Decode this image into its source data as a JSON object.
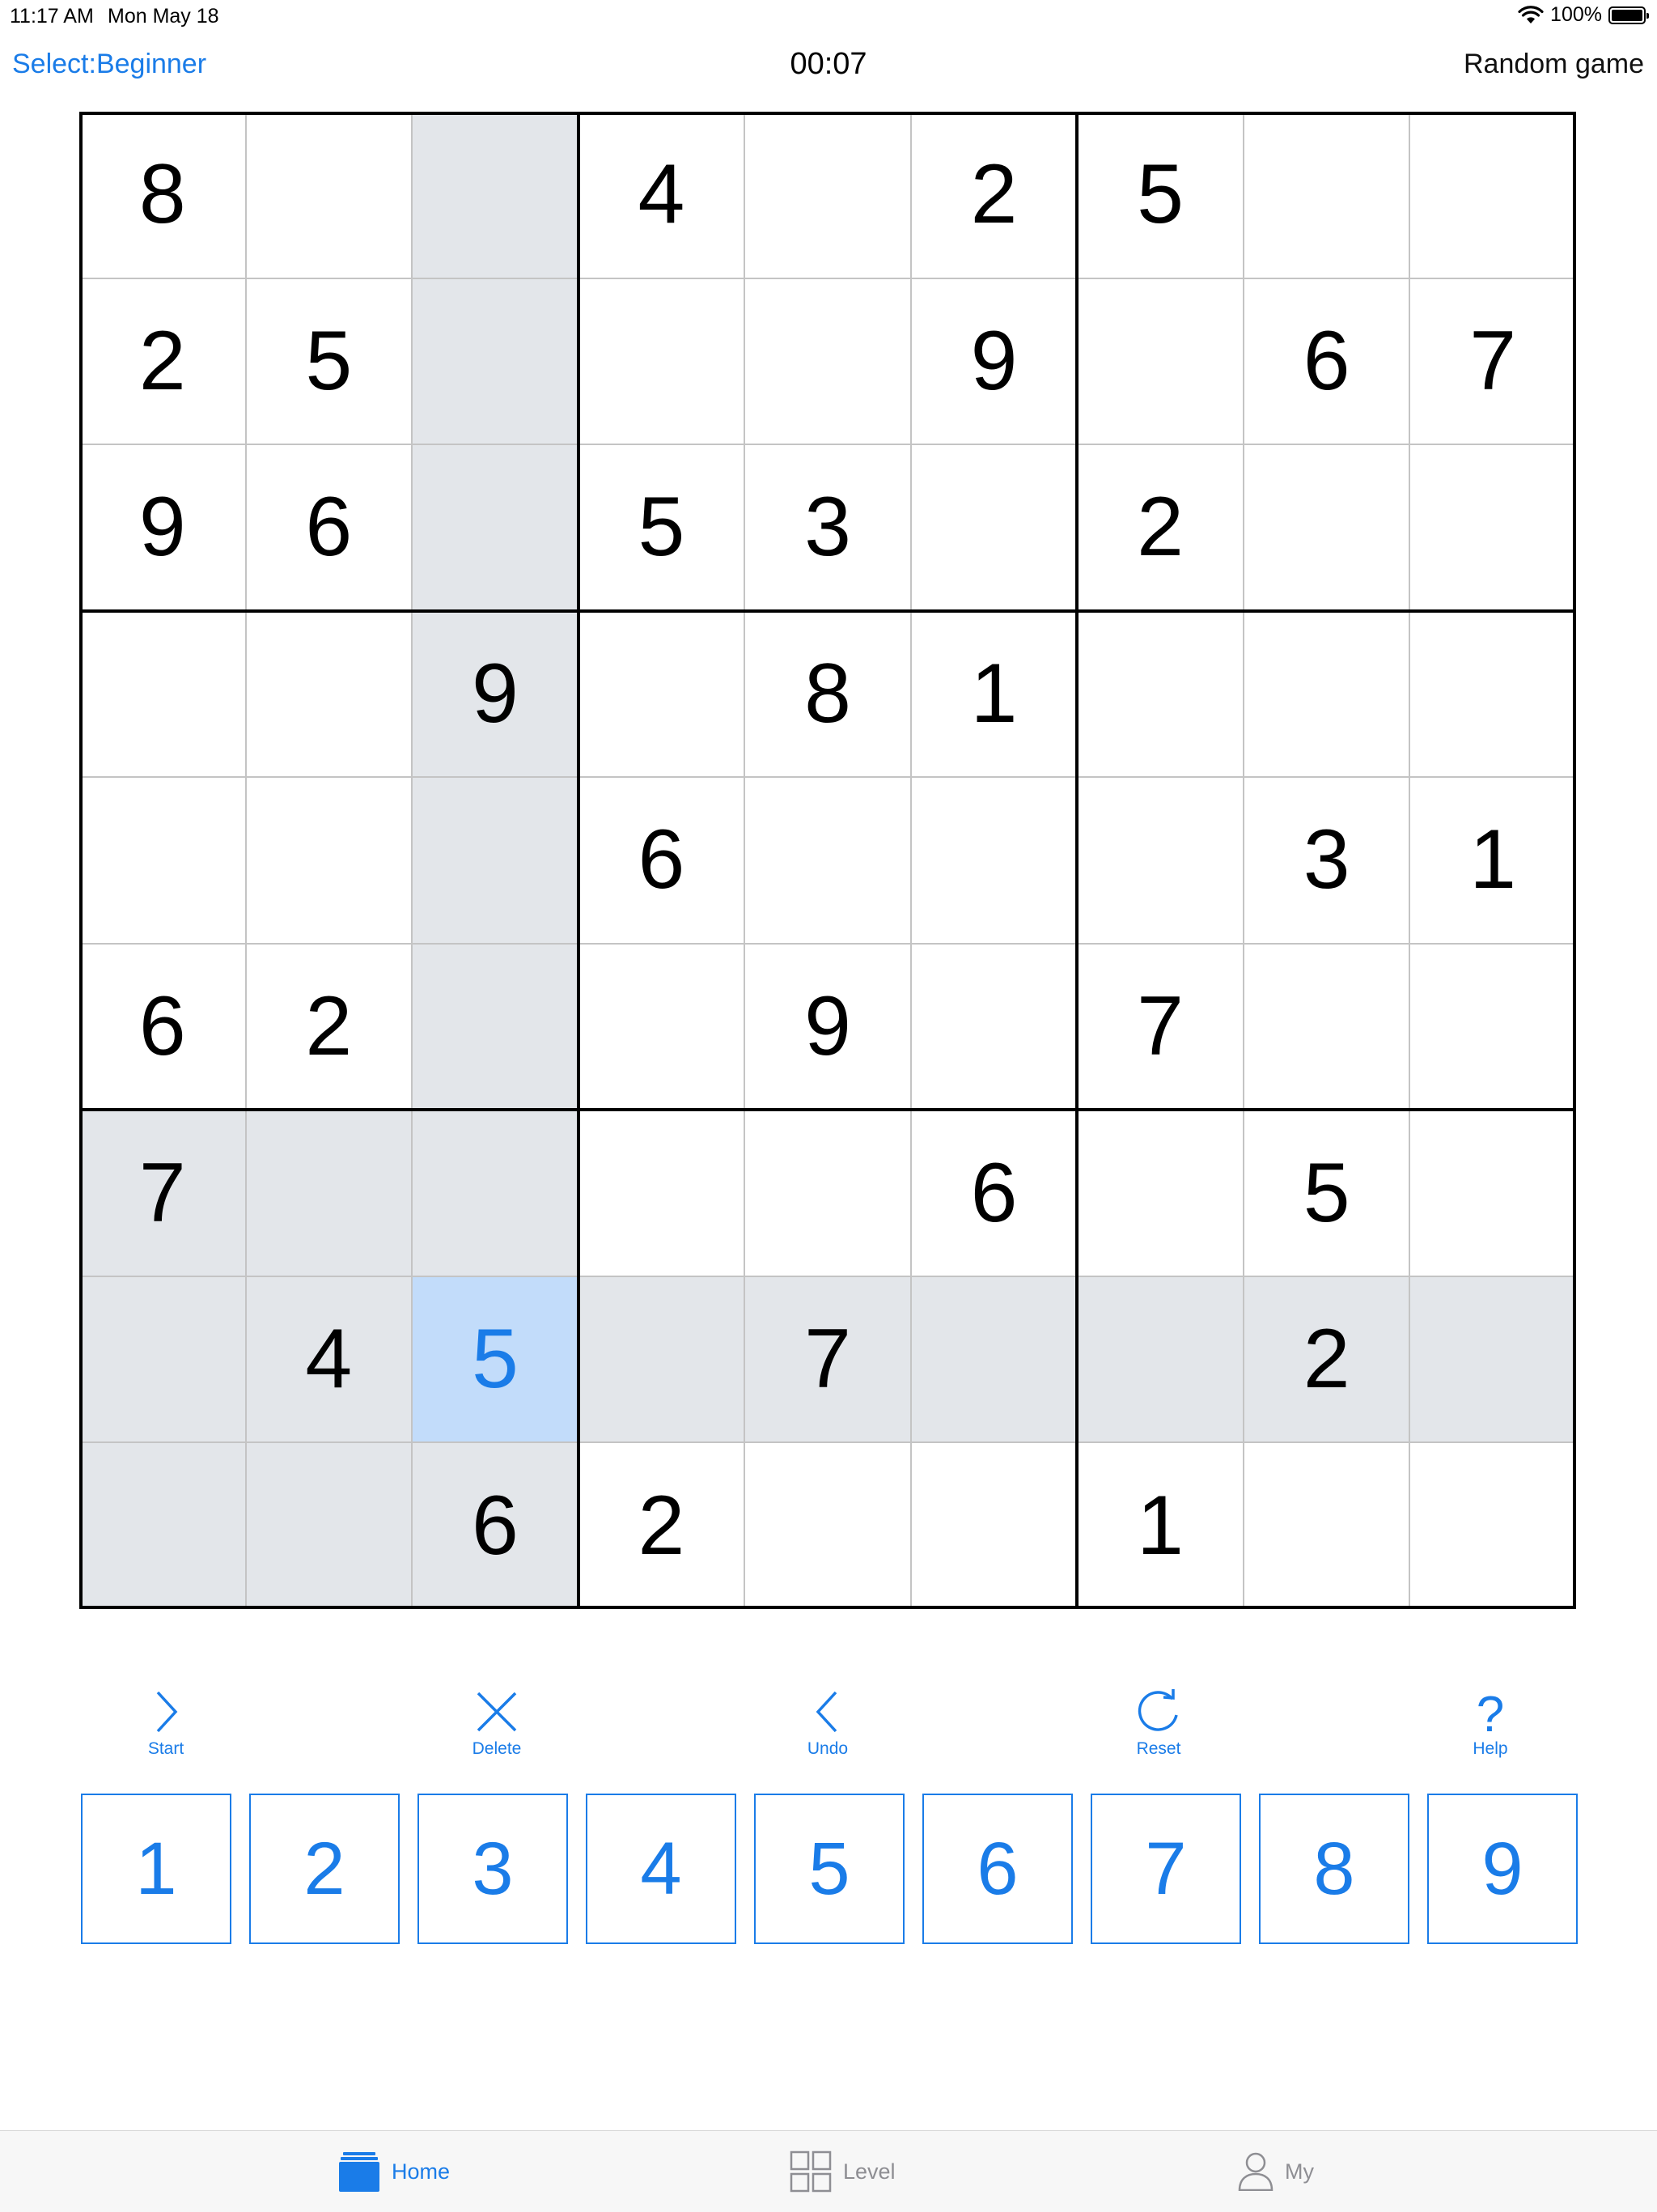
{
  "status_bar": {
    "time": "11:17 AM",
    "date": "Mon May 18",
    "battery": "100%"
  },
  "nav": {
    "left": "Select:Beginner",
    "timer": "00:07",
    "right": "Random game"
  },
  "board": {
    "rows": [
      [
        "8",
        "",
        "",
        "4",
        "",
        "2",
        "5",
        "",
        ""
      ],
      [
        "2",
        "5",
        "",
        "",
        "",
        "9",
        "",
        "6",
        "7"
      ],
      [
        "9",
        "6",
        "",
        "5",
        "3",
        "",
        "2",
        "",
        ""
      ],
      [
        "",
        "",
        "9",
        "",
        "8",
        "1",
        "",
        "",
        ""
      ],
      [
        "",
        "",
        "",
        "6",
        "",
        "",
        "",
        "3",
        "1"
      ],
      [
        "6",
        "2",
        "",
        "",
        "9",
        "",
        "7",
        "",
        ""
      ],
      [
        "7",
        "",
        "",
        "",
        "",
        "6",
        "",
        "5",
        ""
      ],
      [
        "",
        "4",
        "5",
        "",
        "7",
        "",
        "",
        "2",
        ""
      ],
      [
        "",
        "",
        "6",
        "2",
        "",
        "",
        "1",
        "",
        ""
      ]
    ],
    "selected": {
      "row": 7,
      "col": 2
    }
  },
  "toolbar": [
    {
      "label": "Start",
      "icon": "chevron-right-icon"
    },
    {
      "label": "Delete",
      "icon": "close-icon"
    },
    {
      "label": "Undo",
      "icon": "chevron-left-icon"
    },
    {
      "label": "Reset",
      "icon": "refresh-icon"
    },
    {
      "label": "Help",
      "icon": "question-icon"
    }
  ],
  "keypad": [
    "1",
    "2",
    "3",
    "4",
    "5",
    "6",
    "7",
    "8",
    "9"
  ],
  "tabs": [
    {
      "label": "Home",
      "icon": "home-icon",
      "active": true
    },
    {
      "label": "Level",
      "icon": "grid-icon",
      "active": false
    },
    {
      "label": "My",
      "icon": "person-icon",
      "active": false
    }
  ],
  "colors": {
    "accent": "#1a7ce8",
    "highlight": "#e3e6ea",
    "selected": "#c2dcfa"
  }
}
